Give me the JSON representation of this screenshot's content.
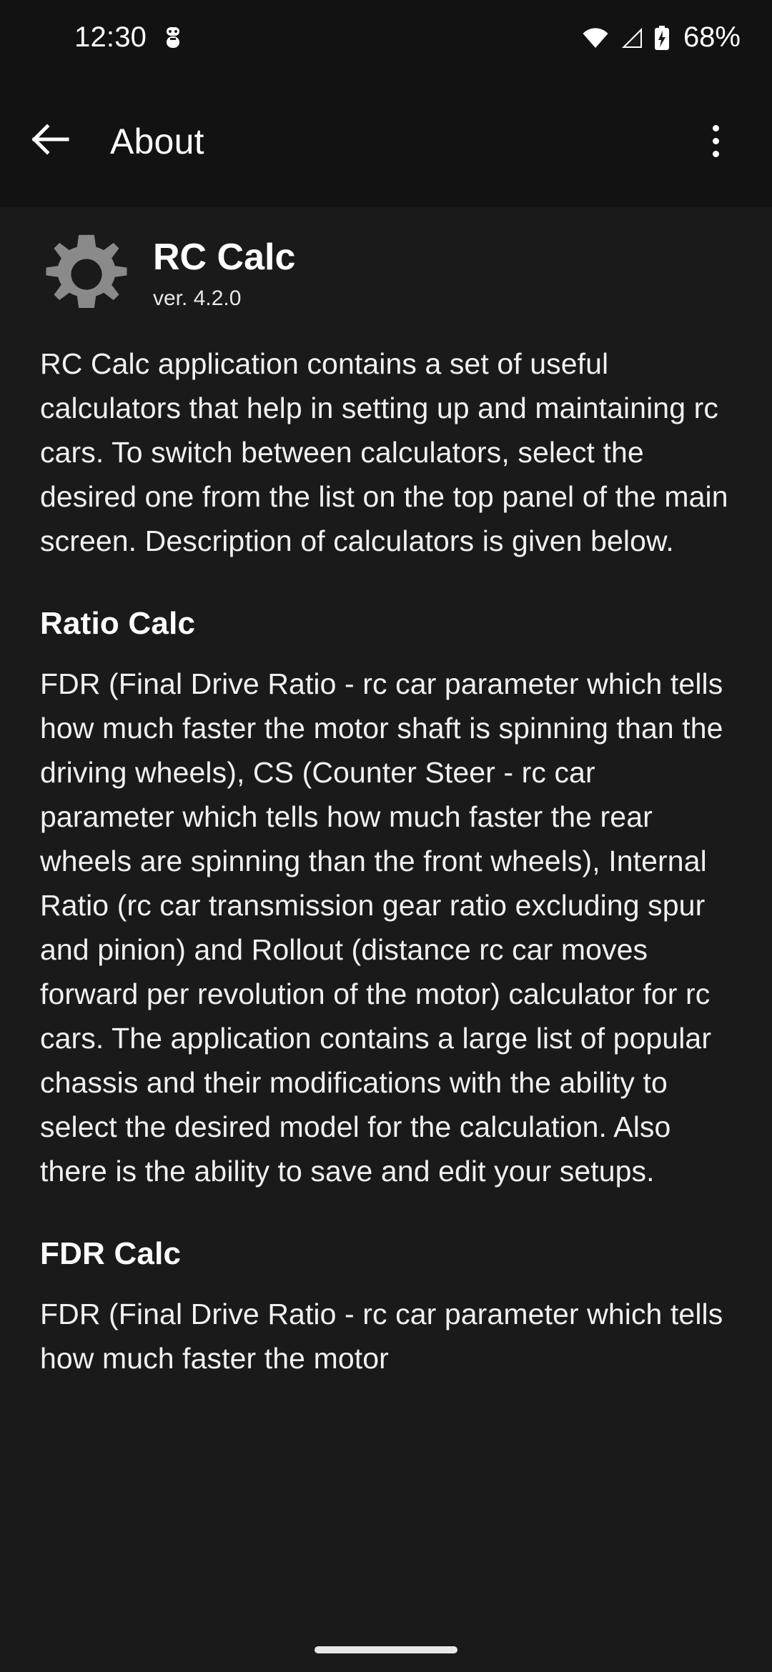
{
  "status_bar": {
    "time": "12:30",
    "battery_percent": "68%",
    "icons": [
      "bug-icon",
      "wifi-icon",
      "cellular-signal-icon",
      "battery-charging-icon"
    ]
  },
  "toolbar": {
    "title": "About",
    "back_icon": "back-arrow-icon",
    "overflow_icon": "overflow-menu-icon"
  },
  "app": {
    "icon": "gear-icon",
    "name": "RC Calc",
    "version": "ver. 4.2.0",
    "intro": "RC Calc application contains a set of useful calculators that help in setting up and maintaining rc cars. To switch between calculators, select the desired one from the list on the top panel of the main screen. Description of calculators is given below."
  },
  "sections": [
    {
      "heading": "Ratio Calc",
      "body": "FDR (Final Drive Ratio - rc car parameter which tells how much faster the motor shaft is spinning than the driving wheels), CS (Counter Steer - rc car parameter which tells how much faster the rear wheels are spinning than the front wheels), Internal Ratio (rc car transmission gear ratio excluding spur and pinion) and Rollout (distance rc car moves forward per revolution of the motor) calculator for rc cars. The application contains a large list of popular chassis and their modifications with the ability to select the desired model for the calculation. Also there is the ability to save and edit your setups."
    },
    {
      "heading": "FDR Calc",
      "body": "FDR (Final Drive Ratio - rc car parameter which tells how much faster the motor"
    }
  ],
  "navigation": {
    "pill": "home-gesture-pill"
  },
  "colors": {
    "window_background": "#121212",
    "content_background": "#1a1a1a",
    "text_primary": "#ffffff",
    "text_body": "#f1f1f1",
    "app_icon": "#8a8a8a"
  }
}
